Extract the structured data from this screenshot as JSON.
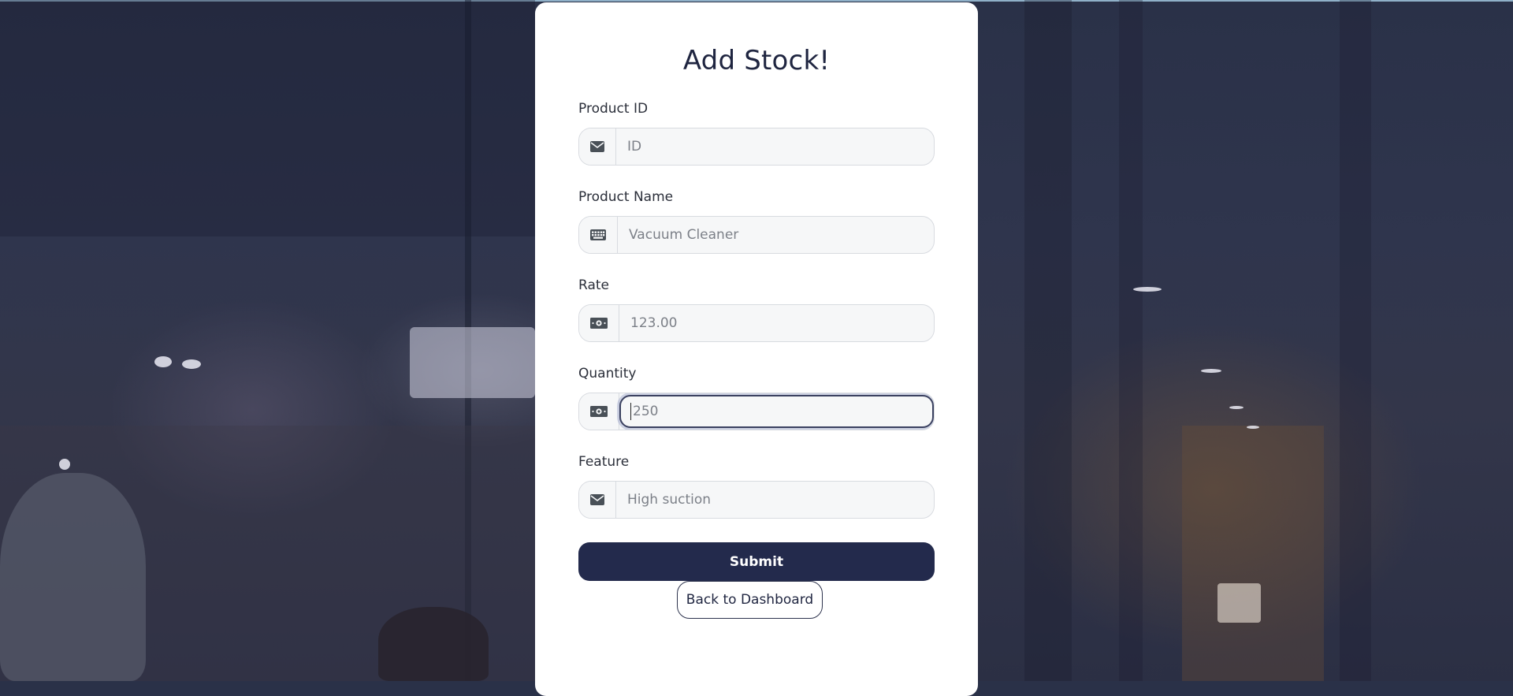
{
  "page": {
    "title": "Add Stock!",
    "colors": {
      "primary": "#232a4c",
      "card_bg": "#ffffff",
      "input_bg": "#f6f7f8"
    }
  },
  "form": {
    "fields": [
      {
        "label": "Product ID",
        "placeholder": "ID",
        "value": "",
        "icon": "envelope-icon"
      },
      {
        "label": "Product Name",
        "placeholder": "Vacuum Cleaner",
        "value": "",
        "icon": "keyboard-icon"
      },
      {
        "label": "Rate",
        "placeholder": "123.00",
        "value": "",
        "icon": "money-bill-icon"
      },
      {
        "label": "Quantity",
        "placeholder": "250",
        "value": "",
        "icon": "money-bill-icon",
        "focused": true
      },
      {
        "label": "Feature",
        "placeholder": "High suction",
        "value": "",
        "icon": "envelope-icon"
      }
    ],
    "submit_label": "Submit",
    "back_label": "Back to Dashboard"
  }
}
